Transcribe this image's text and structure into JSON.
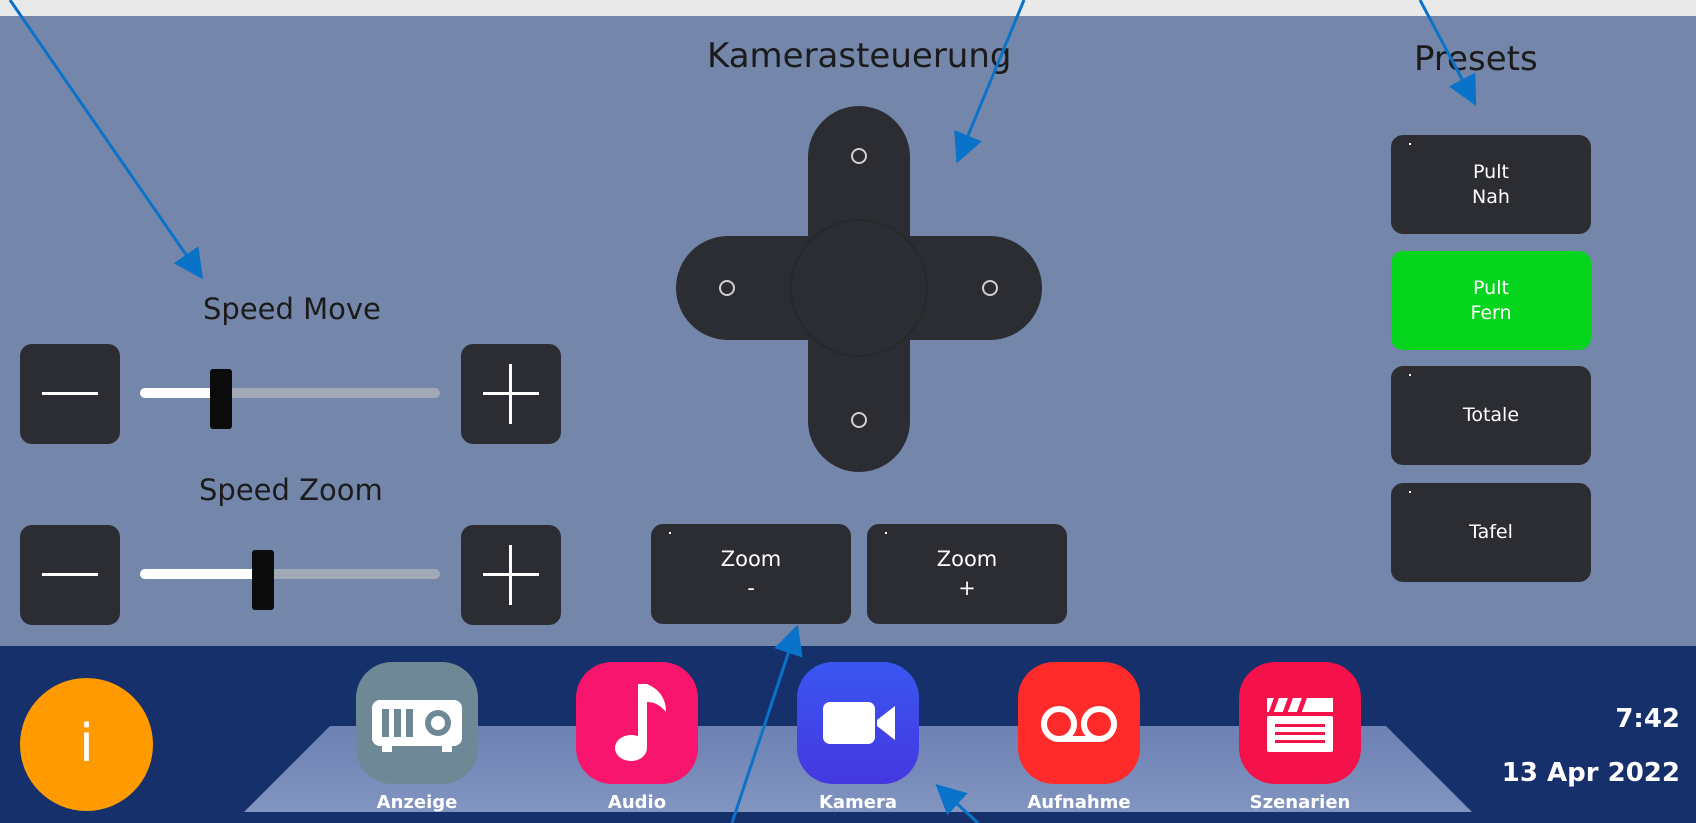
{
  "camera_control": {
    "title": "Kamerasteuerung"
  },
  "presets": {
    "title": "Presets",
    "items": [
      {
        "line1": "Pult",
        "line2": "Nah",
        "active": false
      },
      {
        "line1": "Pult",
        "line2": "Fern",
        "active": true
      },
      {
        "line1": "Totale",
        "line2": "",
        "active": false
      },
      {
        "line1": "Tafel",
        "line2": "",
        "active": false
      }
    ]
  },
  "speed_move": {
    "label": "Speed Move",
    "value_fraction": 0.27
  },
  "speed_zoom": {
    "label": "Speed Zoom",
    "value_fraction": 0.41
  },
  "zoom_minus": {
    "line1": "Zoom",
    "line2": "-"
  },
  "zoom_plus": {
    "line1": "Zoom",
    "line2": "+"
  },
  "apps": [
    {
      "label": "Anzeige",
      "icon": "projector-icon",
      "color": "#6f8895"
    },
    {
      "label": "Audio",
      "icon": "music-note-icon",
      "color": "#f7156e"
    },
    {
      "label": "Kamera",
      "icon": "video-camera-icon",
      "color": "#3b4bf0"
    },
    {
      "label": "Aufnahme",
      "icon": "voicemail-icon",
      "color": "#ff2b2b"
    },
    {
      "label": "Szenarien",
      "icon": "clapperboard-icon",
      "color": "#f51149"
    }
  ],
  "info_button": {
    "label": "i",
    "color": "#ff9a00"
  },
  "clock": {
    "time": "7:42",
    "date": "13 Apr 2022"
  },
  "colors": {
    "panel_bg": "#7487ab",
    "bottom_bar_bg": "#15306b",
    "button_bg": "#2b2d33",
    "preset_active": "#05d51d",
    "annotation_arrow": "#0a73c9"
  }
}
